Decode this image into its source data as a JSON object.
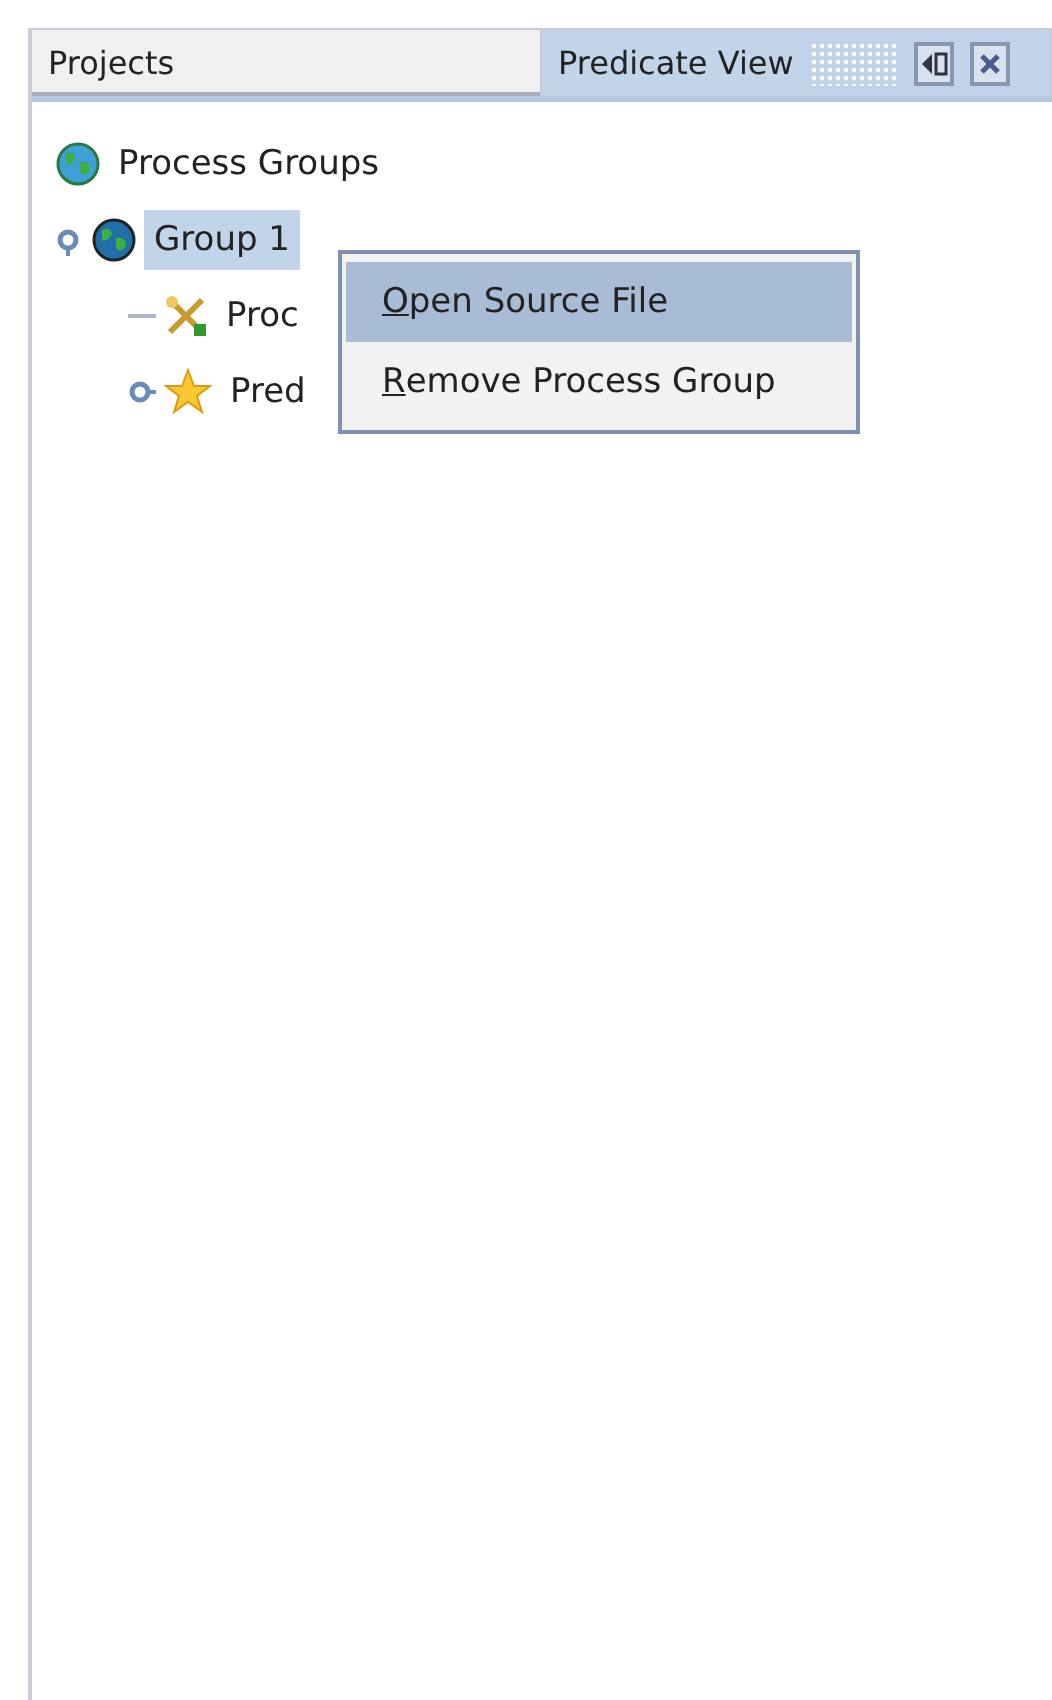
{
  "tabs": [
    {
      "label": "Projects",
      "selected": false
    },
    {
      "label": "Predicate View",
      "selected": true
    }
  ],
  "tree": [
    {
      "label": "Process Groups",
      "kind": "globe",
      "children": [
        {
          "label": "Group 1",
          "kind": "globe-dark",
          "selected": true,
          "expanded": true,
          "children": [
            {
              "label": "Proc",
              "kind": "tools",
              "selected": false
            },
            {
              "label": "Pred",
              "kind": "star",
              "selected": false,
              "expanded": false
            }
          ]
        }
      ]
    }
  ],
  "context_menu": [
    {
      "label": "Open Source File",
      "selected": true
    },
    {
      "label": "Remove Process Group",
      "selected": false
    }
  ]
}
